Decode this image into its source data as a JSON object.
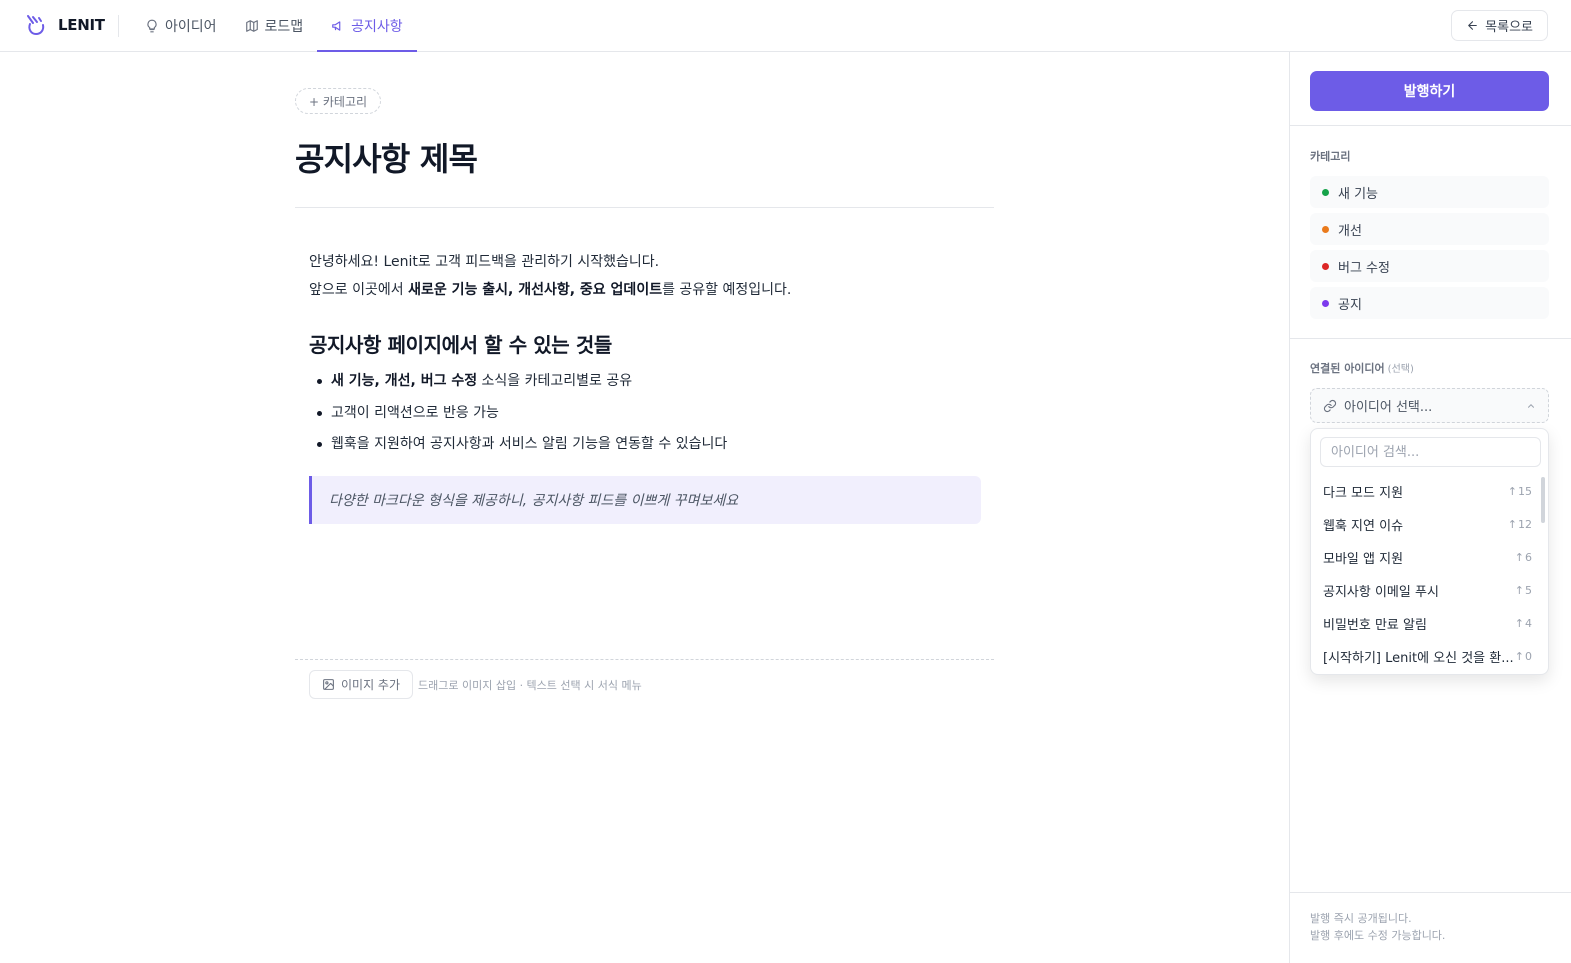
{
  "app": {
    "name": "LENIT"
  },
  "nav": {
    "items": [
      {
        "label": "아이디어",
        "icon": "lightbulb-icon"
      },
      {
        "label": "로드맵",
        "icon": "map-icon"
      },
      {
        "label": "공지사항",
        "icon": "megaphone-icon",
        "active": true
      }
    ],
    "back_label": "목록으로"
  },
  "editor": {
    "category_add": "+ 카테고리",
    "title": "공지사항 제목",
    "intro_line1": "안녕하세요! Lenit로 고객 피드백을 관리하기 시작했습니다.",
    "intro_line2_pre": "앞으로 이곳에서 ",
    "intro_line2_b1": "새로운 기능 출시",
    "intro_sep": ", ",
    "intro_line2_b2": "개선사항",
    "intro_line2_b3": "중요 업데이트",
    "intro_line2_post": "를 공유할 예정입니다.",
    "heading": "공지사항 페이지에서 할 수 있는 것들",
    "bullet1_b1": "새 기능",
    "bullet1_b2": "개선",
    "bullet1_b3": "버그 수정",
    "bullet1_post": " 소식을 카테고리별로 공유",
    "bullet2": "고객이 리액션으로 반응 가능",
    "bullet3": "웹훅을 지원하여 공지사항과 서비스 알림 기능을 연동할 수 있습니다",
    "quote": "다양한 마크다운 형식을 제공하니, 공지사항 피드를 이쁘게 꾸며보세요",
    "add_image": "이미지 추가",
    "hint": "드래그로 이미지 삽입 · 텍스트 선택 시 서식 메뉴"
  },
  "sidebar": {
    "publish": "발행하기",
    "category_label": "카테고리",
    "categories": [
      {
        "label": "새 기능",
        "color": "#16a34a"
      },
      {
        "label": "개선",
        "color": "#ea7a1c"
      },
      {
        "label": "버그 수정",
        "color": "#dc2626"
      },
      {
        "label": "공지",
        "color": "#7c3aed"
      }
    ],
    "linked_label": "연결된 아이디어",
    "linked_sub": "(선택)",
    "select_placeholder": "아이디어 선택...",
    "search_placeholder": "아이디어 검색...",
    "ideas": [
      {
        "name": "다크 모드 지원",
        "votes": "15"
      },
      {
        "name": "웹훅 지연 이슈",
        "votes": "12"
      },
      {
        "name": "모바일 앱 지원",
        "votes": "6"
      },
      {
        "name": "공지사항 이메일 푸시",
        "votes": "5"
      },
      {
        "name": "비밀번호 만료 알림",
        "votes": "4"
      },
      {
        "name": "[시작하기] Lenit에 오신 것을 환...",
        "votes": "0"
      }
    ],
    "foot_line1": "발행 즉시 공개됩니다.",
    "foot_line2": "발행 후에도 수정 가능합니다."
  },
  "colors": {
    "accent": "#6d5ce7",
    "border": "#e5e7eb"
  }
}
